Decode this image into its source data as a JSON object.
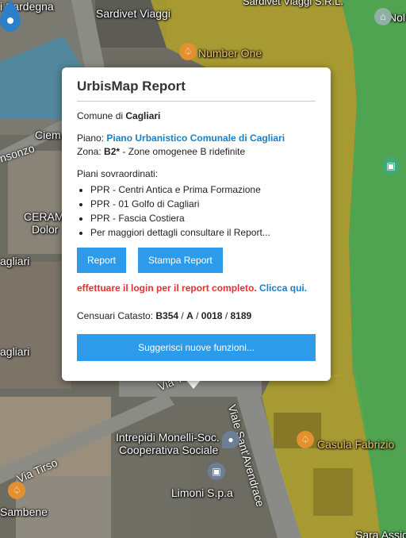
{
  "map": {
    "labels": {
      "sardegna": "i Sardegna",
      "sardivet_viaggi": "Sardivet Viaggi",
      "sardivet_viaggi_srl": "Sardivet Viaggi S.R.L.",
      "number_one": "Number One",
      "nol": "Nol",
      "ciem": "Ciem",
      "nsonzo": "nsonzo",
      "cerame": "CERAM",
      "dolor": "Dolor",
      "agliari": "agliari",
      "via_tevere": "Via Tevere",
      "viale_santavendrace": "Viale Sant'Avendrace",
      "via_tirso": "Via Tirso",
      "intrepidi_line1": "Intrepidi Monelli-Soc.",
      "intrepidi_line2": "Cooperativa Sociale",
      "casula_fabrizio": "Casula Fabrizio",
      "limoni": "Limoni S.p.a",
      "sambene": "Sambene",
      "sara_assicur": "Sara Assicur"
    },
    "icons": {
      "fork": "fork-knife-icon",
      "shop": "shopping-bag-icon",
      "pin": "location-pin-icon",
      "museum": "museum-icon"
    },
    "colors": {
      "yellow_zone": "#b5a52a",
      "green_zone": "#4caa4f",
      "blue_zone": "#4c8aa5",
      "marker": "#2d7fc7"
    }
  },
  "popup": {
    "title": "UrbisMap Report",
    "comune_prefix": "Comune di ",
    "comune_name": "Cagliari",
    "piano_label": "Piano: ",
    "piano_link": "Piano Urbanistico Comunale di Cagliari",
    "zona_label": "Zona: ",
    "zona_code": "B2*",
    "zona_desc": " - Zone omogenee B ridefinite",
    "piani_header": "Piani sovraordinati:",
    "piani_items": [
      "PPR - Centri Antica e Prima Formazione",
      "PPR - 01 Golfo di Cagliari",
      "PPR - Fascia Costiera",
      "Per maggiori dettagli consultare il Report..."
    ],
    "report_button": "Report",
    "stampa_button": "Stampa Report",
    "login_warning": "effettuare il login per il report completo.",
    "login_link": "Clicca qui.",
    "catasto_label": "Censuari Catasto: ",
    "catasto_foglio": "B354",
    "catasto_sep1": " / ",
    "catasto_sezione": "A",
    "catasto_sep2": " / ",
    "catasto_part": "0018",
    "catasto_sep3": " / ",
    "catasto_sub": "8189",
    "suggest_button": "Suggerisci nuove funzioni..."
  }
}
